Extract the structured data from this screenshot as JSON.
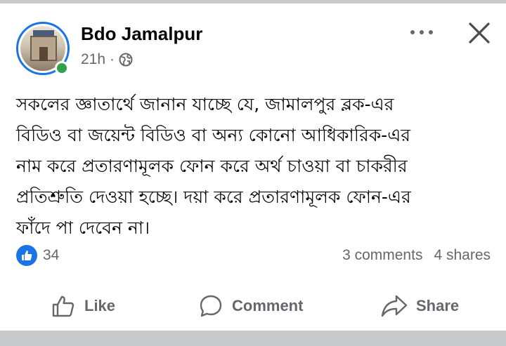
{
  "post": {
    "page_name": "Bdo Jamalpur",
    "time": "21h",
    "separator": "·",
    "text": "সকলের জ্ঞাতার্থে জানান যাচ্ছে যে, জামালপুর ব্লক-এর\nবিডিও বা জয়েন্ট বিডিও বা অন্য কোনো আধিকারিক-এর\nনাম করে প্রতারণামূলক ফোন করে অর্থ চাওয়া বা চাকরীর\nপ্রতিশ্রুতি দেওয়া হচ্ছে। দয়া করে প্রতারণামূলক ফোন-এর\nফাঁদে পা দেবেন না।",
    "privacy_icon": "globe-icon"
  },
  "engagement": {
    "reaction_count": "34",
    "comments": "3 comments",
    "shares": "4 shares"
  },
  "actions": {
    "like": "Like",
    "comment": "Comment",
    "share": "Share"
  },
  "colors": {
    "accent": "#1b74e4",
    "online": "#31a24c",
    "secondary_text": "#65676b"
  }
}
